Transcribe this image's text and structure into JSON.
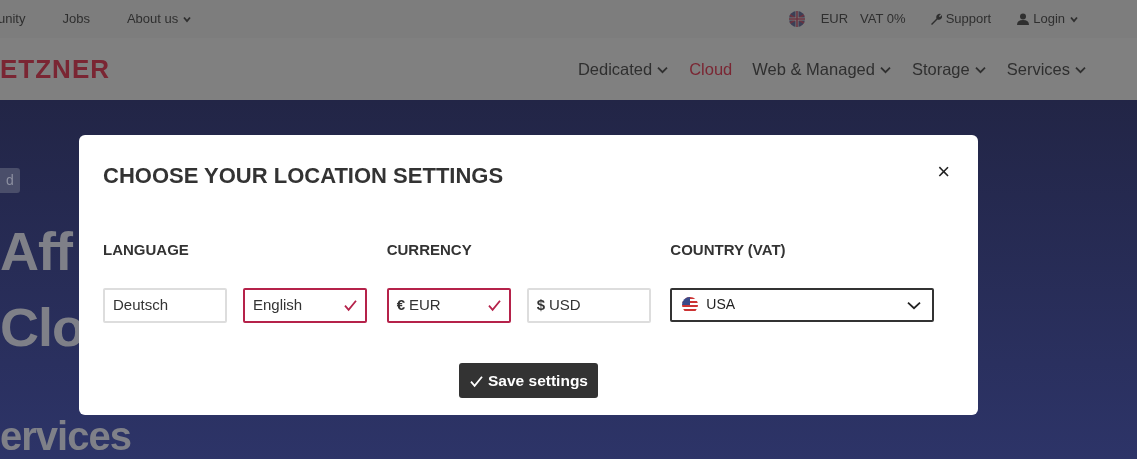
{
  "topbar": {
    "links": [
      {
        "label": "unity",
        "dropdown": false
      },
      {
        "label": "Jobs",
        "dropdown": false
      },
      {
        "label": "About us",
        "dropdown": true
      }
    ],
    "currency": "EUR",
    "vat": "VAT 0%",
    "support": "Support",
    "login": "Login"
  },
  "navbar": {
    "logo": "ETZNER",
    "items": [
      {
        "label": "Dedicated",
        "dropdown": true,
        "selected": false
      },
      {
        "label": "Cloud",
        "dropdown": false,
        "selected": true
      },
      {
        "label": "Web & Managed",
        "dropdown": true,
        "selected": false
      },
      {
        "label": "Storage",
        "dropdown": true,
        "selected": false
      },
      {
        "label": "Services",
        "dropdown": true,
        "selected": false
      }
    ]
  },
  "hero": {
    "badge": "d",
    "lines": [
      "Aff",
      "Clo",
      "ervices"
    ]
  },
  "modal": {
    "title": "CHOOSE YOUR LOCATION SETTINGS",
    "close": "×",
    "groups": [
      {
        "label": "LANGUAGE",
        "kind": "options",
        "options": [
          {
            "label": "Deutsch",
            "selected": false
          },
          {
            "label": "English",
            "selected": true
          }
        ]
      },
      {
        "label": "CURRENCY",
        "kind": "options",
        "options": [
          {
            "symbol": "€",
            "label": "EUR",
            "selected": true
          },
          {
            "symbol": "$",
            "label": "USD",
            "selected": false
          }
        ]
      },
      {
        "label": "COUNTRY (VAT)",
        "kind": "select",
        "value": "USA"
      }
    ],
    "save_button": "Save settings"
  }
}
